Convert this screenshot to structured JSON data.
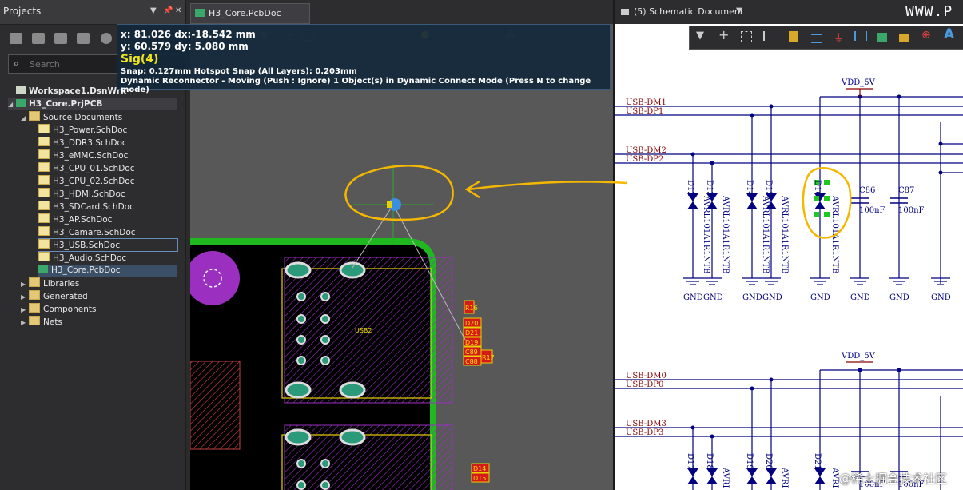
{
  "projects_panel": {
    "title": "Projects",
    "search_placeholder": "Search",
    "tree": [
      {
        "label": "Workspace1.DsnWrk",
        "kind": "workspace",
        "level": 0
      },
      {
        "label": "H3_Core.PrjPCB",
        "kind": "project",
        "level": 0
      },
      {
        "label": "Source Documents",
        "kind": "folder",
        "level": 1
      },
      {
        "label": "H3_Power.SchDoc",
        "kind": "schdoc",
        "level": 2
      },
      {
        "label": "H3_DDR3.SchDoc",
        "kind": "schdoc",
        "level": 2
      },
      {
        "label": "H3_eMMC.SchDoc",
        "kind": "schdoc",
        "level": 2
      },
      {
        "label": "H3_CPU_01.SchDoc",
        "kind": "schdoc",
        "level": 2
      },
      {
        "label": "H3_CPU_02.SchDoc",
        "kind": "schdoc",
        "level": 2
      },
      {
        "label": "H3_HDMI.SchDoc",
        "kind": "schdoc",
        "level": 2
      },
      {
        "label": "H3_SDCard.SchDoc",
        "kind": "schdoc",
        "level": 2
      },
      {
        "label": "H3_AP.SchDoc",
        "kind": "schdoc",
        "level": 2
      },
      {
        "label": "H3_Camare.SchDoc",
        "kind": "schdoc",
        "level": 2
      },
      {
        "label": "H3_USB.SchDoc",
        "kind": "schdoc",
        "level": 2
      },
      {
        "label": "H3_Audio.SchDoc",
        "kind": "schdoc",
        "level": 2
      },
      {
        "label": "H3_Core.PcbDoc",
        "kind": "pcbdoc",
        "level": 2
      },
      {
        "label": "Libraries",
        "kind": "folder",
        "level": 1
      },
      {
        "label": "Generated",
        "kind": "folder",
        "level": 1
      },
      {
        "label": "Components",
        "kind": "folder",
        "level": 1
      },
      {
        "label": "Nets",
        "kind": "folder",
        "level": 1
      }
    ]
  },
  "pcb": {
    "tab_label": "H3_Core.PcbDoc",
    "hud": {
      "coord_line1": "x: 81.026   dx:-18.542 mm",
      "coord_line2": "y: 60.579   dy:  5.080  mm",
      "net": "Sig(4)",
      "snap": "Snap: 0.127mm Hotspot Snap (All Layers): 0.203mm",
      "mode": "Dynamic Reconnector - Moving (Push : Ignore) 1 Object(s) in Dynamic Connect Mode (Press N to change mode)"
    },
    "labels": {
      "usb_connector": "USB2",
      "ref_pads": [
        "R16",
        "D20",
        "D21",
        "D19",
        "C89",
        "C88",
        "R17",
        "D14",
        "D15"
      ]
    }
  },
  "schematic": {
    "tab_label": "(5) Schematic Document",
    "header_text": "WWW.P",
    "net_labels_top": [
      "USB-DM1",
      "USB-DP1",
      "USB-DM2",
      "USB-DP2"
    ],
    "net_labels_bottom": [
      "USB-DM0",
      "USB-DP0",
      "USB-DM3",
      "USB-DP3"
    ],
    "power": "VDD_5V",
    "designators_top": [
      "D12",
      "D13",
      "D14",
      "D15",
      "D16"
    ],
    "designators_bottom": [
      "D17",
      "D18",
      "D19",
      "D20",
      "D21"
    ],
    "part_value": "AVRL101A1R1NTB",
    "part_value_short": "AVRI",
    "caps_top": [
      {
        "ref": "C86",
        "value": "100nF"
      },
      {
        "ref": "C87",
        "value": "100nF"
      }
    ],
    "cap_value_bottom": "100nF",
    "gnd": "GND"
  },
  "watermark": "@稀土掘金技术社区",
  "colors": {
    "annotation": "#f5b800",
    "pcb_outline": "#1fb81f",
    "pad_purple": "#9b30c0",
    "wire_navy": "#000080",
    "net_red": "#8b0000"
  }
}
